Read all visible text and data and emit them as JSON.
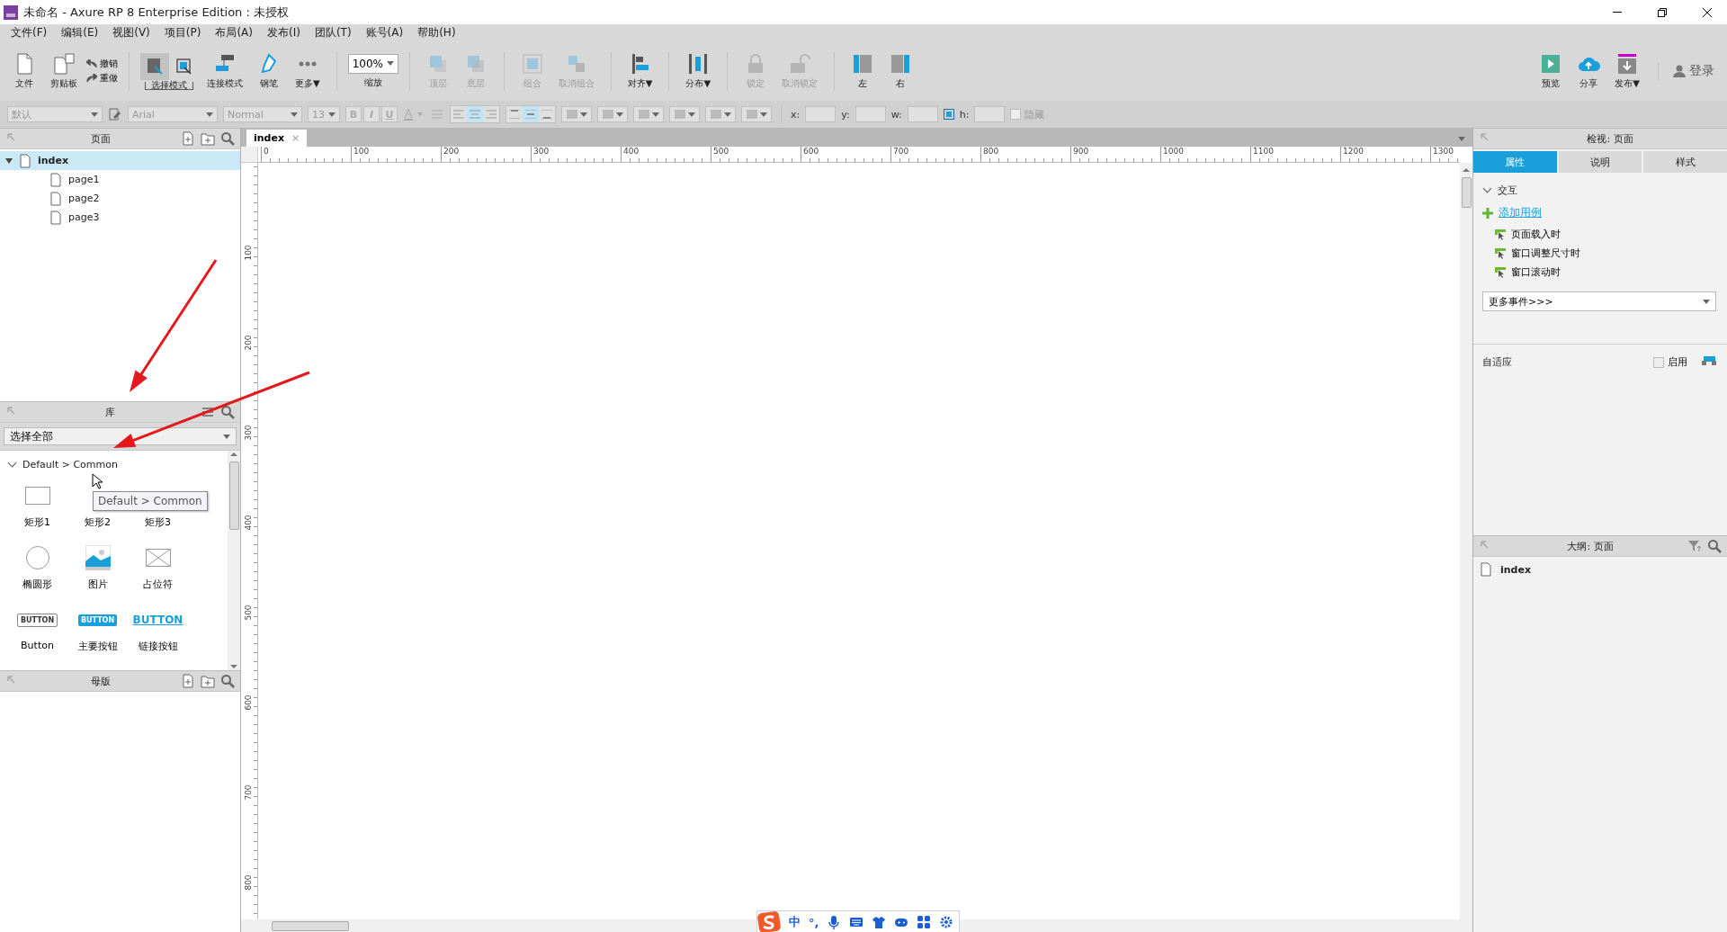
{
  "window": {
    "title": "未命名 - Axure RP 8 Enterprise Edition : 未授权"
  },
  "menu": [
    "文件(F)",
    "编辑(E)",
    "视图(V)",
    "项目(P)",
    "布局(A)",
    "发布(I)",
    "团队(T)",
    "账号(A)",
    "帮助(H)"
  ],
  "toolbar": {
    "left": [
      {
        "kind": "file",
        "label": "文件",
        "disabled": false
      },
      {
        "kind": "clipboard",
        "label": "剪贴板",
        "disabled": false
      },
      {
        "kind": "history",
        "items": [
          "撤销",
          "重做"
        ]
      },
      {
        "kind": "sep"
      },
      {
        "kind": "modes",
        "label": "选择模式",
        "modes": [
          {
            "selected": true
          },
          {
            "selected": false
          }
        ]
      },
      {
        "kind": "connect",
        "label": "连接模式",
        "disabled": false
      },
      {
        "kind": "pen",
        "label": "钢笔",
        "disabled": false
      },
      {
        "kind": "more",
        "label": "更多▼",
        "disabled": false
      },
      {
        "kind": "sep"
      },
      {
        "kind": "zoom",
        "value": "100%",
        "label": "缩放"
      },
      {
        "kind": "sep"
      },
      {
        "kind": "front",
        "label": "顶层",
        "disabled": true
      },
      {
        "kind": "back",
        "label": "底层",
        "disabled": true
      },
      {
        "kind": "sep"
      },
      {
        "kind": "group",
        "label": "组合",
        "disabled": true
      },
      {
        "kind": "ungroup",
        "label": "取消组合",
        "disabled": true
      },
      {
        "kind": "sep"
      },
      {
        "kind": "align",
        "label": "对齐▼",
        "disabled": false
      },
      {
        "kind": "sep"
      },
      {
        "kind": "distribute",
        "label": "分布▼",
        "disabled": false
      },
      {
        "kind": "sep"
      },
      {
        "kind": "lock",
        "label": "锁定",
        "disabled": true
      },
      {
        "kind": "unlock",
        "label": "取消锁定",
        "disabled": true
      },
      {
        "kind": "sep"
      },
      {
        "kind": "left",
        "label": "左",
        "disabled": false
      },
      {
        "kind": "right",
        "label": "右",
        "disabled": false
      }
    ],
    "right": [
      {
        "kind": "preview",
        "label": "预览",
        "disabled": false
      },
      {
        "kind": "share",
        "label": "分享",
        "disabled": false
      },
      {
        "kind": "publish",
        "label": "发布▼",
        "disabled": false
      }
    ],
    "login": "登录"
  },
  "format_bar": {
    "style": "默认",
    "font": "Arial",
    "weight": "Normal",
    "size": "13",
    "text_styles": [
      "B",
      "I",
      "U"
    ],
    "h_align": [
      {
        "selected": false
      },
      {
        "selected": true
      },
      {
        "selected": false
      }
    ],
    "v_align": [
      {
        "selected": false
      },
      {
        "selected": true
      },
      {
        "selected": false
      }
    ],
    "coords": [
      "x:",
      "y:",
      "w:",
      "h:"
    ],
    "hidden": {
      "label": "隐藏",
      "checked": false
    }
  },
  "pages": {
    "title": "页面",
    "tree": [
      {
        "label": "index",
        "expanded": true,
        "selected": true,
        "children": [
          {
            "label": "page1",
            "selected": false
          },
          {
            "label": "page2",
            "selected": false
          },
          {
            "label": "page3",
            "selected": false
          }
        ]
      }
    ]
  },
  "library": {
    "title": "库",
    "select": "选择全部",
    "section": {
      "label": "Default > Common",
      "expanded": true
    },
    "widgets": [
      {
        "kind": "rect",
        "label": "矩形1"
      },
      {
        "kind": "covered",
        "label": "矩形2"
      },
      {
        "kind": "covered",
        "label": "矩形3"
      },
      {
        "kind": "ellipse",
        "label": "椭圆形"
      },
      {
        "kind": "image",
        "label": "图片"
      },
      {
        "kind": "placeholder",
        "label": "占位符"
      },
      {
        "kind": "button",
        "label": "Button",
        "text": "BUTTON"
      },
      {
        "kind": "primary",
        "label": "主要按钮",
        "text": "BUTTON"
      },
      {
        "kind": "link",
        "label": "链接按钮",
        "text": "BUTTON"
      }
    ],
    "tooltip": "Default > Common"
  },
  "masters": {
    "title": "母版"
  },
  "canvas": {
    "tab": {
      "label": "index",
      "close": "×"
    },
    "top_ruler": [
      "0",
      "100",
      "200",
      "300",
      "400",
      "500",
      "600",
      "700",
      "800",
      "900",
      "1000",
      "1100",
      "1200",
      "1300"
    ],
    "left_ruler": [
      "100",
      "200",
      "300",
      "400",
      "500",
      "600",
      "700",
      "800"
    ]
  },
  "inspector": {
    "title": "检视: 页面",
    "tabs": [
      {
        "label": "属性",
        "selected": true
      },
      {
        "label": "说明",
        "selected": false
      },
      {
        "label": "样式",
        "selected": false
      }
    ],
    "section": {
      "label": "交互",
      "expanded": true
    },
    "add_case": "添加用例",
    "events": [
      "页面载入时",
      "窗口调整尺寸时",
      "窗口滚动时"
    ],
    "more_events": "更多事件>>>",
    "adaptive": {
      "label": "自适应",
      "checkbox": {
        "label": "启用",
        "checked": false
      }
    }
  },
  "outline": {
    "title": "大纲: 页面",
    "items": [
      "index"
    ]
  },
  "annotations": [
    {
      "kind": "arrow"
    },
    {
      "kind": "arrow"
    }
  ],
  "ime_bar": {
    "items": [
      {
        "kind": "logo"
      },
      {
        "kind": "text",
        "text": "中"
      },
      {
        "kind": "text",
        "text": "°,"
      },
      {
        "kind": "mic"
      },
      {
        "kind": "keyboard"
      },
      {
        "kind": "shirt"
      },
      {
        "kind": "gamepad"
      },
      {
        "kind": "grid"
      },
      {
        "kind": "gear"
      }
    ]
  }
}
